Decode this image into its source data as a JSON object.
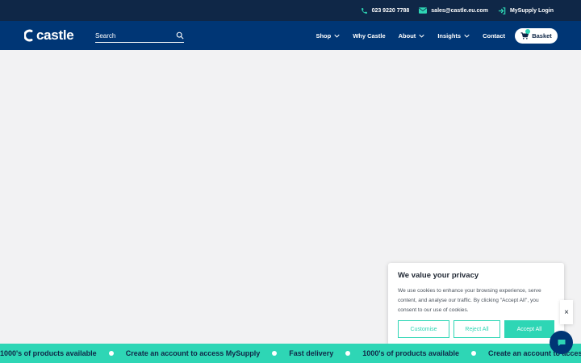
{
  "topbar": {
    "phone": "023 9220 7788",
    "email": "sales@castle.eu.com",
    "login": "MySupply Login"
  },
  "nav": {
    "logo": "castle",
    "search_placeholder": "Search",
    "menu": [
      {
        "label": "Shop",
        "dropdown": true
      },
      {
        "label": "Why Castle",
        "dropdown": false
      },
      {
        "label": "About",
        "dropdown": true
      },
      {
        "label": "Insights",
        "dropdown": true
      },
      {
        "label": "Contact",
        "dropdown": false
      }
    ],
    "basket": "Basket"
  },
  "cookie": {
    "title": "We value your privacy",
    "text": "We use cookies to enhance your browsing experience, serve content, and analyse our traffic. By clicking \"Accept All\", you consent to our use of cookies.",
    "customise": "Customise",
    "reject": "Reject All",
    "accept": "Accept All"
  },
  "side_close": "×",
  "ticker": {
    "items": [
      "1000's of products available",
      "Create an account to access MySupply",
      "Fast delivery",
      "1000's of products available",
      "Create an account to access MySupply"
    ]
  },
  "colors": {
    "topbar": "#0f2747",
    "nav": "#003675",
    "accent": "#2ed6b5",
    "page": "#f2f2f3"
  }
}
